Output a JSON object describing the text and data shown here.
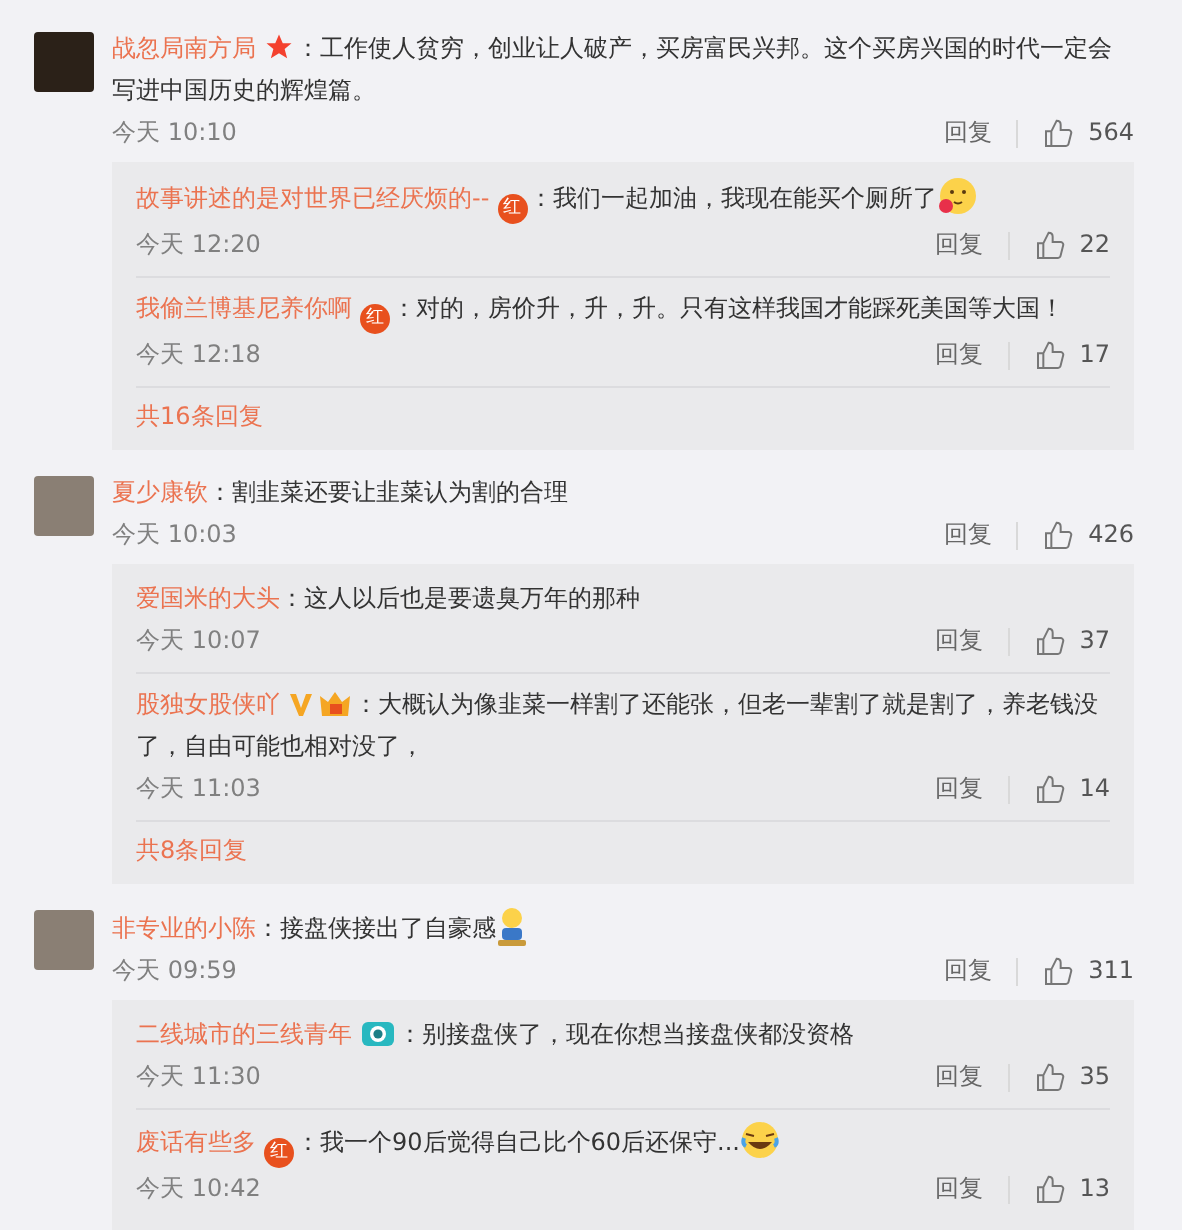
{
  "comments": [
    {
      "user": "战忽局南方局",
      "badge": {
        "kind": "star"
      },
      "text": "：工作使人贫穷，创业让人破产，买房富民兴邦。这个买房兴国的时代一定会写进中国历史的辉煌篇。",
      "time": "今天 10:10",
      "reply_label": "回复",
      "likes": "564",
      "avatar": {
        "kind": "emblem"
      },
      "replies": [
        {
          "user": "故事讲述的是对世界已经厌烦的--",
          "badge": {
            "kind": "red",
            "text": "红"
          },
          "text": "：我们一起加油，我现在能买个厕所了",
          "emoji": {
            "kind": "blush"
          },
          "time": "今天 12:20",
          "reply_label": "回复",
          "likes": "22"
        },
        {
          "user": "我偷兰博基尼养你啊",
          "badge": {
            "kind": "red",
            "text": "红"
          },
          "text": "：对的，房价升，升，升。只有这样我国才能踩死美国等大国！",
          "time": "今天 12:18",
          "reply_label": "回复",
          "likes": "17"
        }
      ],
      "more": "共16条回复"
    },
    {
      "user": "夏少康钦",
      "text": "：割韭菜还要让韭菜认为割的合理",
      "time": "今天 10:03",
      "reply_label": "回复",
      "likes": "426",
      "avatar": {
        "kind": "photo"
      },
      "replies": [
        {
          "user": "爱国米的大头",
          "text": "：这人以后也是要遗臭万年的那种",
          "time": "今天 10:07",
          "reply_label": "回复",
          "likes": "37"
        },
        {
          "user": "股独女股侠吖",
          "badge": {
            "kind": "vcrown"
          },
          "text": "：大概认为像韭菜一样割了还能张，但老一辈割了就是割了，养老钱没了，自由可能也相对没了，",
          "time": "今天 11:03",
          "reply_label": "回复",
          "likes": "14"
        }
      ],
      "more": "共8条回复"
    },
    {
      "user": "非专业的小陈",
      "text": "：接盘侠接出了自豪感",
      "emoji": {
        "kind": "figure"
      },
      "time": "今天 09:59",
      "reply_label": "回复",
      "likes": "311",
      "avatar": {
        "kind": "photo"
      },
      "replies": [
        {
          "user": "二线城市的三线青年",
          "badge": {
            "kind": "camera"
          },
          "text": "：别接盘侠了，现在你想当接盘侠都没资格",
          "time": "今天 11:30",
          "reply_label": "回复",
          "likes": "35"
        },
        {
          "user": "废话有些多",
          "badge": {
            "kind": "red",
            "text": "红"
          },
          "text": "：我一个90后觉得自己比个60后还保守...",
          "emoji": {
            "kind": "laughcry"
          },
          "time": "今天 10:42",
          "reply_label": "回复",
          "likes": "13"
        }
      ]
    }
  ]
}
